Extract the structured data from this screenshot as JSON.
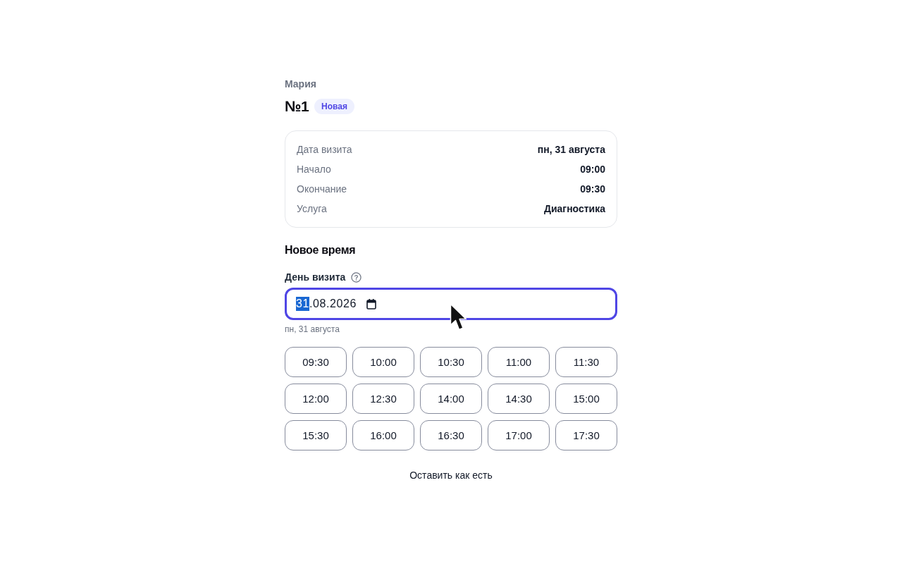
{
  "client": {
    "name": "Мария"
  },
  "appointment": {
    "number": "№1",
    "status": {
      "label": "Новая"
    }
  },
  "details": [
    {
      "label": "Дата визита",
      "value": "пн, 31 августа"
    },
    {
      "label": "Начало",
      "value": "09:00"
    },
    {
      "label": "Окончание",
      "value": "09:30"
    },
    {
      "label": "Услуга",
      "value": "Диагностика"
    }
  ],
  "reschedule": {
    "title": "Новое время",
    "date_field": {
      "label": "День визита",
      "focused": true,
      "segments": [
        {
          "text": "31",
          "selected": true
        },
        {
          "text": ".08.2026",
          "selected": false
        }
      ],
      "hint": "пн, 31 августа"
    },
    "time_slots": [
      {
        "time": "09:30",
        "selected": false
      },
      {
        "time": "10:00",
        "selected": false
      },
      {
        "time": "10:30",
        "selected": false
      },
      {
        "time": "11:00",
        "selected": false
      },
      {
        "time": "11:30",
        "selected": false
      },
      {
        "time": "12:00",
        "selected": false
      },
      {
        "time": "12:30",
        "selected": false
      },
      {
        "time": "14:00",
        "selected": false
      },
      {
        "time": "14:30",
        "selected": false
      },
      {
        "time": "15:00",
        "selected": false
      },
      {
        "time": "15:30",
        "selected": false
      },
      {
        "time": "16:00",
        "selected": false
      },
      {
        "time": "16:30",
        "selected": false
      },
      {
        "time": "17:00",
        "selected": false
      },
      {
        "time": "17:30",
        "selected": false
      }
    ],
    "keep_button": {
      "label": "Оставить как есть"
    }
  }
}
